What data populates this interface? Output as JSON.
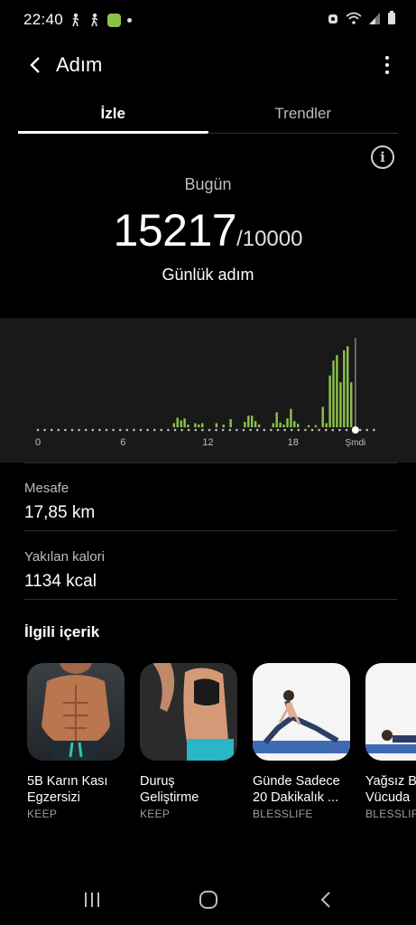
{
  "status_bar": {
    "time": "22:40"
  },
  "app_bar": {
    "title": "Adım"
  },
  "tabs": [
    {
      "label": "İzle",
      "active": true
    },
    {
      "label": "Trendler",
      "active": false
    }
  ],
  "summary": {
    "period": "Bugün",
    "steps": "15217",
    "goal": "/10000",
    "caption": "Günlük adım"
  },
  "chart_data": {
    "type": "bar",
    "x_tick_labels": [
      "0",
      "6",
      "12",
      "18",
      "Şmdi"
    ],
    "x_range_hours": [
      0,
      24
    ],
    "bar_color": "#8bc34a",
    "values": [
      {
        "hour": 9.6,
        "steps": 60
      },
      {
        "hour": 9.85,
        "steps": 140
      },
      {
        "hour": 10.1,
        "steps": 100
      },
      {
        "hour": 10.35,
        "steps": 130
      },
      {
        "hour": 10.6,
        "steps": 40
      },
      {
        "hour": 11.1,
        "steps": 60
      },
      {
        "hour": 11.35,
        "steps": 40
      },
      {
        "hour": 11.6,
        "steps": 60
      },
      {
        "hour": 12.6,
        "steps": 60
      },
      {
        "hour": 13.1,
        "steps": 40
      },
      {
        "hour": 13.6,
        "steps": 120
      },
      {
        "hour": 14.6,
        "steps": 80
      },
      {
        "hour": 14.85,
        "steps": 170
      },
      {
        "hour": 15.1,
        "steps": 170
      },
      {
        "hour": 15.35,
        "steps": 90
      },
      {
        "hour": 15.6,
        "steps": 40
      },
      {
        "hour": 16.6,
        "steps": 60
      },
      {
        "hour": 16.85,
        "steps": 220
      },
      {
        "hour": 17.1,
        "steps": 70
      },
      {
        "hour": 17.35,
        "steps": 40
      },
      {
        "hour": 17.6,
        "steps": 130
      },
      {
        "hour": 17.85,
        "steps": 270
      },
      {
        "hour": 18.1,
        "steps": 90
      },
      {
        "hour": 18.35,
        "steps": 50
      },
      {
        "hour": 19.1,
        "steps": 30
      },
      {
        "hour": 19.6,
        "steps": 30
      },
      {
        "hour": 20.1,
        "steps": 300
      },
      {
        "hour": 20.35,
        "steps": 60
      },
      {
        "hour": 20.6,
        "steps": 760
      },
      {
        "hour": 20.85,
        "steps": 980
      },
      {
        "hour": 21.1,
        "steps": 1060
      },
      {
        "hour": 21.35,
        "steps": 660
      },
      {
        "hour": 21.6,
        "steps": 1130
      },
      {
        "hour": 21.85,
        "steps": 1190
      },
      {
        "hour": 22.1,
        "steps": 660
      }
    ],
    "y_max": 1300,
    "now_hour": 22.4
  },
  "stats": {
    "distance": {
      "label": "Mesafe",
      "value": "17,85 km"
    },
    "calories": {
      "label": "Yakılan kalori",
      "value": "1134 kcal"
    }
  },
  "related": {
    "title": "İlgili içerik",
    "items": [
      {
        "title_line1": "5B Karın Kası",
        "title_line2": "Egzersizi",
        "source": "KEEP"
      },
      {
        "title_line1": "Duruş",
        "title_line2": "Geliştirme",
        "source": "KEEP"
      },
      {
        "title_line1": "Günde Sadece",
        "title_line2": "20 Dakikalık ...",
        "source": "BLESSLIFE"
      },
      {
        "title_line1": "Yağsız B",
        "title_line2": "Vücuda",
        "source": "BLESSLIFE"
      }
    ]
  }
}
